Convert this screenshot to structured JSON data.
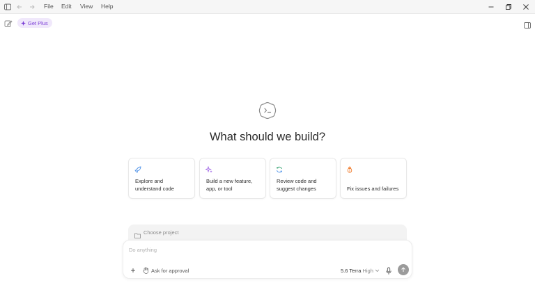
{
  "menu": {
    "file": "File",
    "edit": "Edit",
    "view": "View",
    "help": "Help"
  },
  "toolbar": {
    "get_plus": "Get Plus"
  },
  "main": {
    "headline": "What should we build?",
    "cards": [
      {
        "line1": "Explore and",
        "line2": "understand code"
      },
      {
        "line1": "Build a new feature,",
        "line2": "app, or tool"
      },
      {
        "line1": "Review code and",
        "line2": "suggest changes"
      },
      {
        "line1": "Fix issues and failures",
        "line2": ""
      }
    ]
  },
  "composer": {
    "project_label": "Choose project",
    "placeholder": "Do anything",
    "approval_label": "Ask for approval",
    "model_name": "5.6 Terra",
    "model_effort": "High"
  },
  "colors": {
    "accent_purple": "#7b3fd6",
    "card_icon_blue": "#4a8fe7",
    "card_icon_purple": "#9b5de5",
    "card_icon_green": "#2f9e6e",
    "card_icon_orange": "#f07a2a"
  }
}
